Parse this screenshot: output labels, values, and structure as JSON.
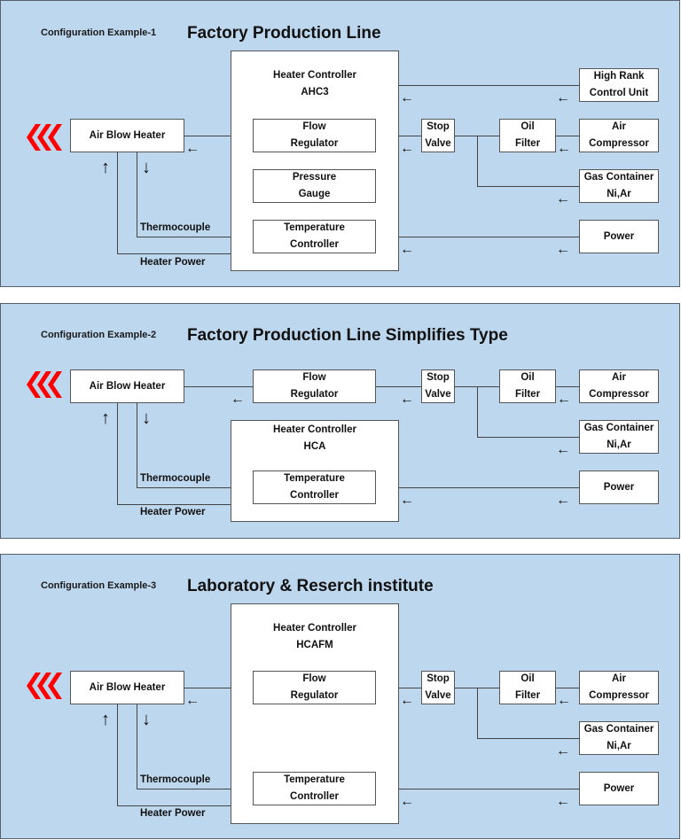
{
  "panels": [
    {
      "subtitle": "Configuration Example-1",
      "title": "Factory Production Line",
      "controller": {
        "line1": "Heater Controller",
        "line2": "AHC3"
      },
      "flow_regulator": {
        "line1": "Flow",
        "line2": "Regulator"
      },
      "pressure_gauge": {
        "line1": "Pressure",
        "line2": "Gauge"
      },
      "temp_controller": {
        "line1": "Temperature",
        "line2": "Controller"
      },
      "air_blow_heater": "Air Blow Heater",
      "high_rank": {
        "line1": "High Rank",
        "line2": "Control Unit"
      },
      "stop_valve": {
        "line1": "Stop",
        "line2": "Valve"
      },
      "oil_filter": {
        "line1": "Oil",
        "line2": "Filter"
      },
      "air_compressor": {
        "line1": "Air",
        "line2": "Compressor"
      },
      "gas_container": {
        "line1": "Gas Container",
        "line2": "Ni,Ar"
      },
      "power": "Power",
      "thermocouple": "Thermocouple",
      "heater_power": "Heater Power"
    },
    {
      "subtitle": "Configuration Example-2",
      "title": "Factory Production Line Simplifies Type",
      "controller": {
        "line1": "Heater Controller",
        "line2": "HCA"
      },
      "flow_regulator": {
        "line1": "Flow",
        "line2": "Regulator"
      },
      "temp_controller": {
        "line1": "Temperature",
        "line2": "Controller"
      },
      "air_blow_heater": "Air Blow Heater",
      "stop_valve": {
        "line1": "Stop",
        "line2": "Valve"
      },
      "oil_filter": {
        "line1": "Oil",
        "line2": "Filter"
      },
      "air_compressor": {
        "line1": "Air",
        "line2": "Compressor"
      },
      "gas_container": {
        "line1": "Gas Container",
        "line2": "Ni,Ar"
      },
      "power": "Power",
      "thermocouple": "Thermocouple",
      "heater_power": "Heater Power"
    },
    {
      "subtitle": "Configuration Example-3",
      "title": "Laboratory & Reserch institute",
      "controller": {
        "line1": "Heater Controller",
        "line2": "HCAFM"
      },
      "flow_regulator": {
        "line1": "Flow",
        "line2": "Regulator"
      },
      "temp_controller": {
        "line1": "Temperature",
        "line2": "Controller"
      },
      "air_blow_heater": "Air Blow Heater",
      "stop_valve": {
        "line1": "Stop",
        "line2": "Valve"
      },
      "oil_filter": {
        "line1": "Oil",
        "line2": "Filter"
      },
      "air_compressor": {
        "line1": "Air",
        "line2": "Compressor"
      },
      "gas_container": {
        "line1": "Gas Container",
        "line2": "Ni,Ar"
      },
      "power": "Power",
      "thermocouple": "Thermocouple",
      "heater_power": "Heater Power"
    }
  ],
  "icons": {
    "left_arrow": "←",
    "up_arrow": "↑",
    "down_arrow": "↓",
    "output_chevrons": "red-triple-chevron"
  },
  "colors": {
    "panel_bg": "#bdd7ee",
    "chevron": "#ff0000"
  }
}
